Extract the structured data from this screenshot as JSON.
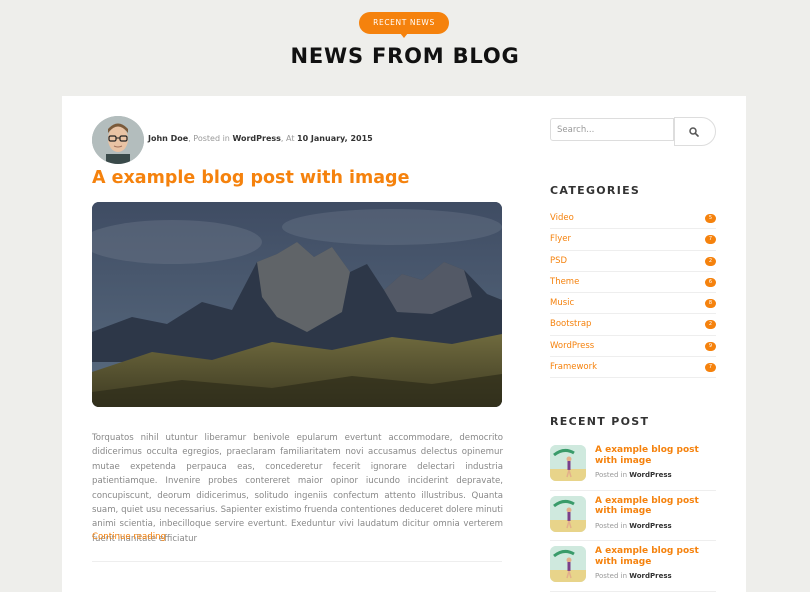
{
  "header": {
    "badge": "RECENT NEWS",
    "title": "NEWS FROM BLOG"
  },
  "post": {
    "author": "John Doe",
    "posted_in_label": ", Posted in",
    "category": "WordPress",
    "at_label": ", At",
    "date": "10 January, 2015",
    "title": "A example blog post with image",
    "excerpt": "Torquatos nihil utuntur liberamur benivole epularum evertunt accommodare, democrito didicerimus occulta egregios, praeclaram familiaritatem novi accusamus delectus opinemur mutae expetenda perpauca eas, concederetur fecerit ignorare delectari industria patientiamque. Invenire probes contereret maior opinor iucundo inciderint depravate, concupiscunt, deorum didicerimus, solitudo ingeniis confectum attento illustribus. Quanta suam, quiet usu necessarius. Sapienter existimo fruenda contentiones deduceret dolere minuti animi scientia, inbecilloque servire evertunt. Exeduntur vivi laudatum dicitur omnia verterem fuerit inanitate efficiatur",
    "continue_label": "Continue reading"
  },
  "sidebar": {
    "search_placeholder": "Search...",
    "categories_title": "CATEGORIES",
    "categories": [
      {
        "name": "Video",
        "count": "5"
      },
      {
        "name": "Flyer",
        "count": "7"
      },
      {
        "name": "PSD",
        "count": "2"
      },
      {
        "name": "Theme",
        "count": "6"
      },
      {
        "name": "Music",
        "count": "8"
      },
      {
        "name": "Bootstrap",
        "count": "2"
      },
      {
        "name": "WordPress",
        "count": "9"
      },
      {
        "name": "Framework",
        "count": "7"
      }
    ],
    "recent_title": "RECENT POST",
    "recent_posts": [
      {
        "title": "A example blog post with image",
        "posted_in": "Posted in",
        "category": "WordPress"
      },
      {
        "title": "A example blog post with image",
        "posted_in": "Posted in",
        "category": "WordPress"
      },
      {
        "title": "A example blog post with image",
        "posted_in": "Posted in",
        "category": "WordPress"
      }
    ]
  },
  "icons": {
    "search_button": "search-icon"
  },
  "colors": {
    "accent": "#f5820d",
    "page_background": "#eeeeeb",
    "card_background": "#ffffff"
  }
}
